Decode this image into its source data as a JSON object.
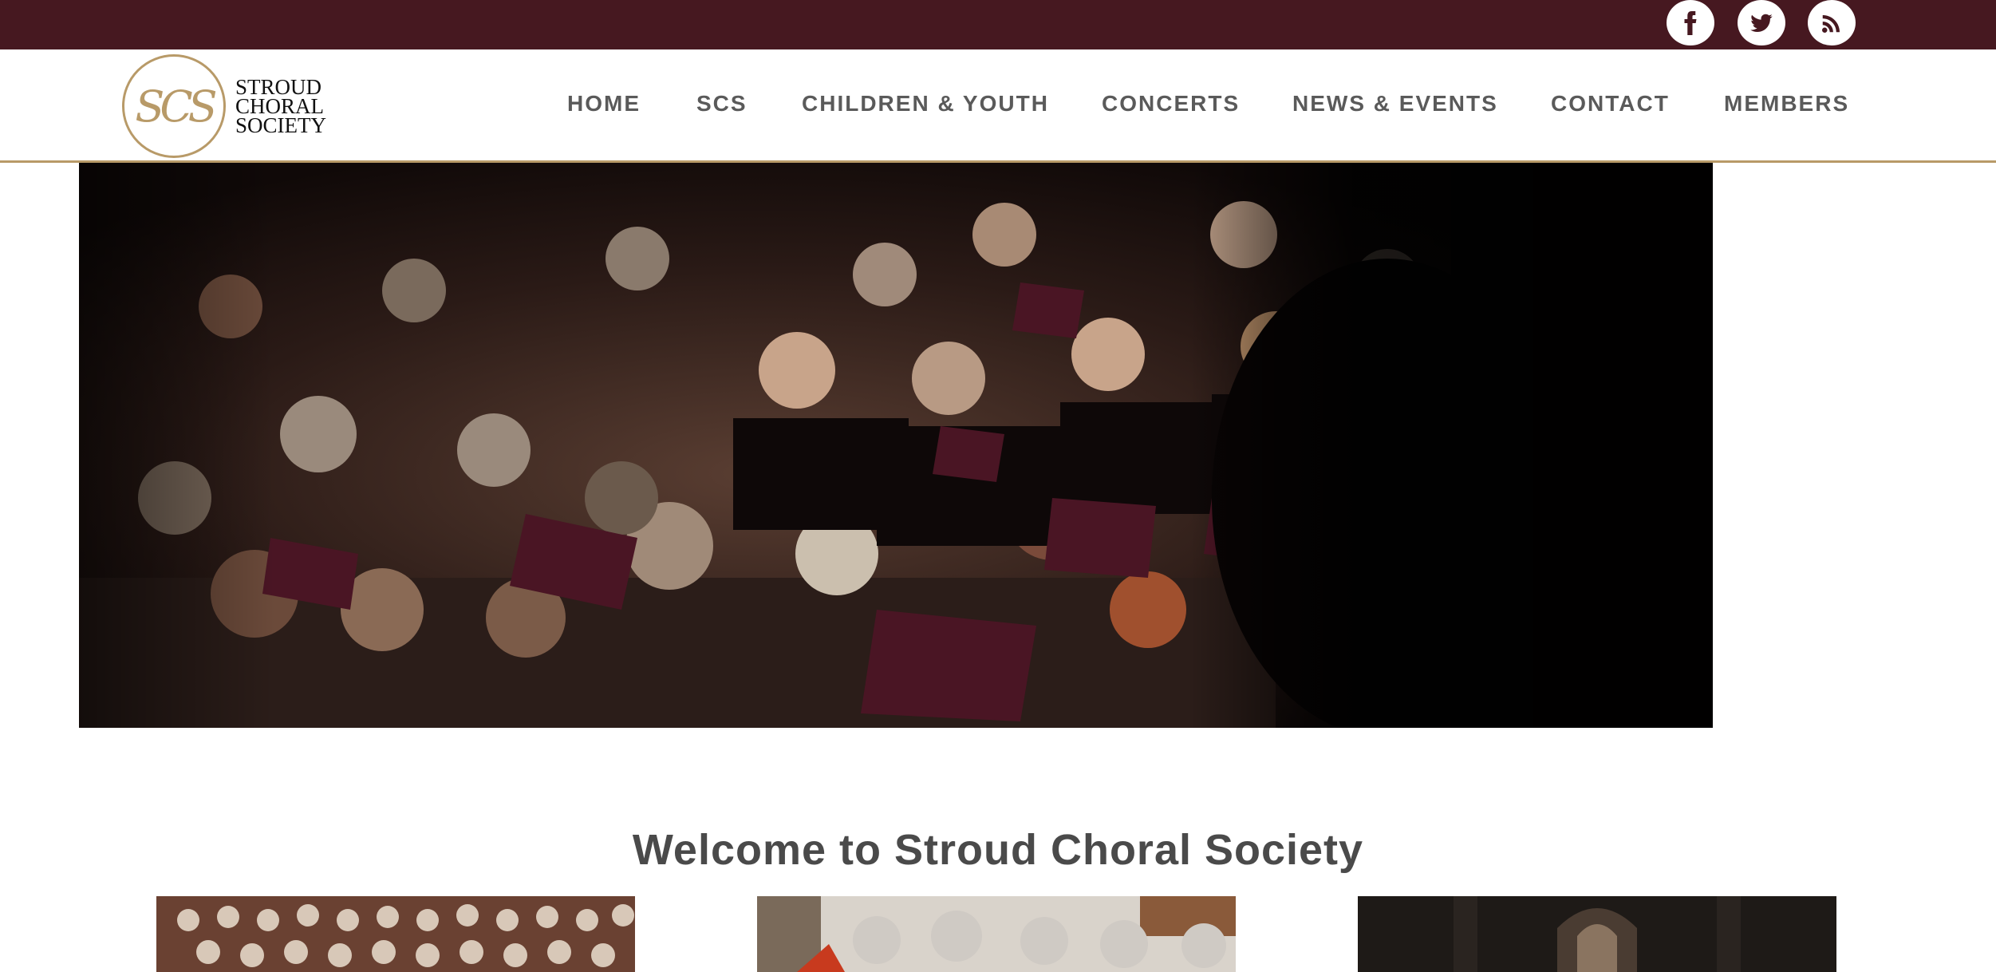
{
  "site": {
    "name_lines": [
      "STROUD",
      "CHORAL",
      "SOCIETY"
    ],
    "monogram": "SCS"
  },
  "social": [
    {
      "name": "facebook-icon",
      "label": "f"
    },
    {
      "name": "twitter-icon"
    },
    {
      "name": "rss-icon"
    }
  ],
  "nav": {
    "items": [
      "HOME",
      "SCS",
      "CHILDREN & YOUTH",
      "CONCERTS",
      "NEWS & EVENTS",
      "CONTACT",
      "MEMBERS"
    ]
  },
  "hero": {
    "alt": "Choir singing in concert"
  },
  "welcome": {
    "title": "Welcome to Stroud Choral Society"
  },
  "colors": {
    "topbar": "#461820",
    "accent_gold": "#b89a68",
    "nav_text": "#5a5a5a",
    "heading_text": "#4a4a4a"
  }
}
